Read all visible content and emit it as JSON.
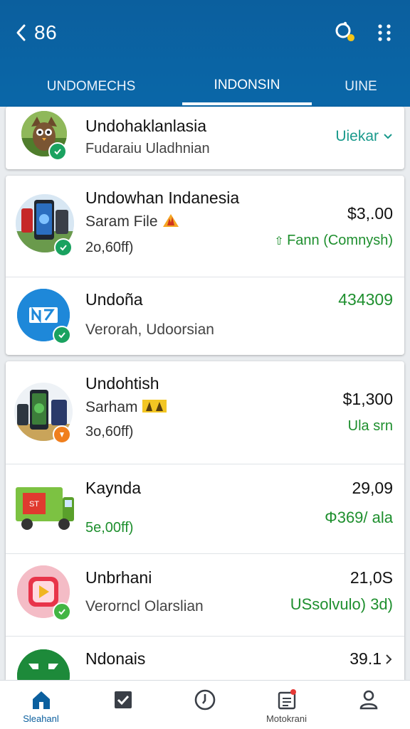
{
  "header": {
    "back_count": "86",
    "colors": {
      "bar": "#0b5f9e",
      "accent": "#1e8f2e"
    },
    "actions": [
      "search-icon",
      "more-vertical-icon"
    ]
  },
  "tabs": [
    {
      "label": "UNDOMECHS"
    },
    {
      "label": "INDONSIN"
    },
    {
      "label": "UINE"
    }
  ],
  "pinned": {
    "title": "Undohaklanlasia",
    "subtitle": "Fudaraiu Uladhnian",
    "dropdown": "Uiekar"
  },
  "group1": [
    {
      "title": "Undowhan Indanesia",
      "subtitle": "Saram File",
      "meta": "2o,60ff)",
      "amount": "$3,.00",
      "status": "Fann (Comnysh)"
    },
    {
      "title": "Undoña",
      "subtitle": "Verorah, Udoorsian",
      "amount": "434309"
    }
  ],
  "group2": [
    {
      "title": "Undohtish",
      "subtitle": "Sarham",
      "meta": "3o,60ff)",
      "amount": "$1,300",
      "status": "Ula srn"
    },
    {
      "title": "Kaynda",
      "meta": "5e,00ff)",
      "amount": "29,09",
      "status": "Φ369/ ala"
    },
    {
      "title": "Unbrhani",
      "subtitle": "Verorncl Olarslian",
      "amount": "21,0S",
      "status": "USsolvulo) 3d)"
    },
    {
      "title": "Ndonais",
      "amount": "39.1"
    }
  ],
  "bottom_nav": [
    {
      "label": "Sleahanl",
      "icon": "home-icon",
      "active": true
    },
    {
      "label": "",
      "icon": "checkbox-icon"
    },
    {
      "label": "",
      "icon": "clock-icon"
    },
    {
      "label": "Motokrani",
      "icon": "clipboard-icon"
    },
    {
      "label": "",
      "icon": "profile-icon"
    }
  ]
}
